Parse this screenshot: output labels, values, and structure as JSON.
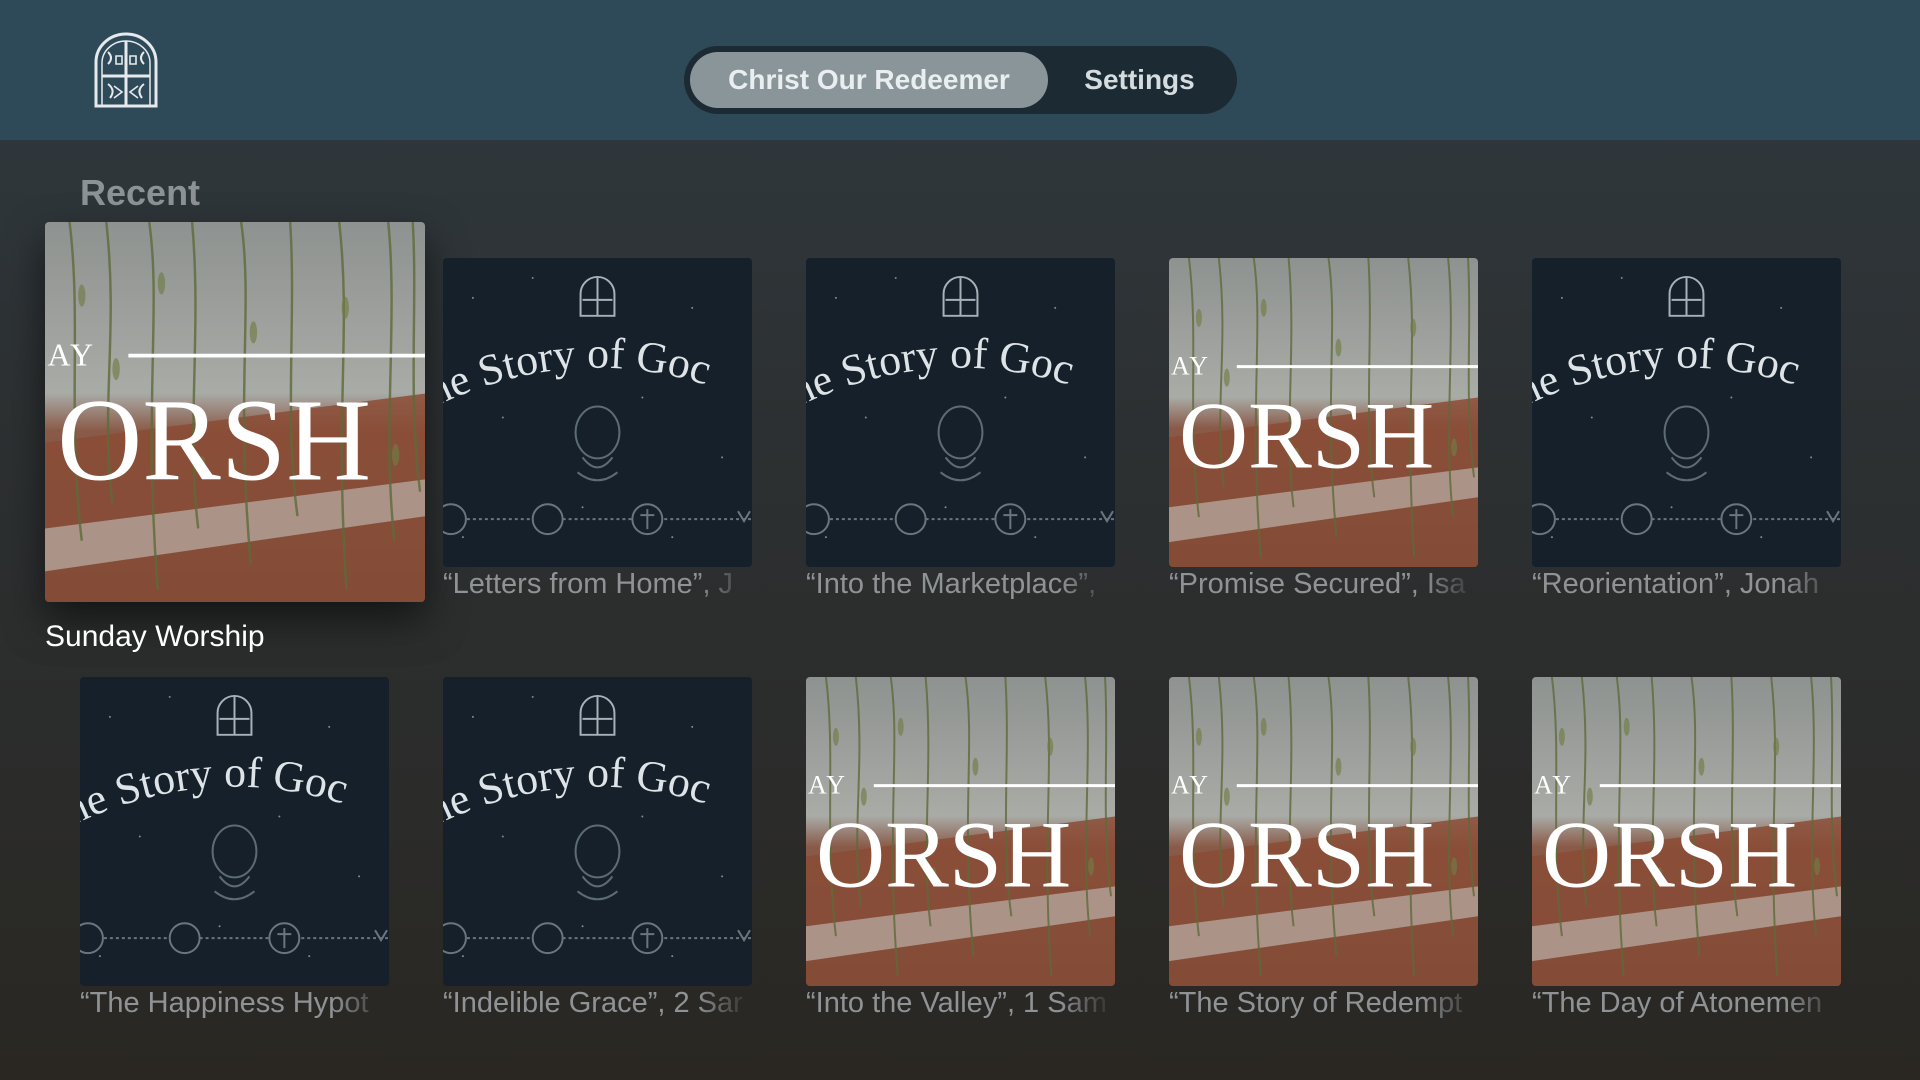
{
  "header": {
    "logo": "church-window-logo",
    "tabs": [
      {
        "label": "Christ Our Redeemer",
        "selected": true
      },
      {
        "label": "Settings",
        "selected": false
      }
    ]
  },
  "section": {
    "title": "Recent"
  },
  "artwork": {
    "worship": {
      "lead": "AY",
      "word": "ORSH"
    },
    "story": {
      "word": "he Story of Goc"
    }
  },
  "items": [
    {
      "title": "Sunday Worship",
      "art": "worship",
      "focused": true
    },
    {
      "title": "“Letters from Home”, J",
      "art": "story"
    },
    {
      "title": "“Into the Marketplace”,",
      "art": "story"
    },
    {
      "title": "“Promise Secured”, Isa",
      "art": "worship"
    },
    {
      "title": "“Reorientation”, Jonah",
      "art": "story"
    },
    {
      "title": "“The Happiness Hypot",
      "art": "story"
    },
    {
      "title": "“Indelible Grace”, 2 Sar",
      "art": "story"
    },
    {
      "title": "“Into the Valley”, 1 Sam",
      "art": "worship"
    },
    {
      "title": "“The Story of Redempt",
      "art": "worship"
    },
    {
      "title": "“The Day of Atonemen",
      "art": "worship"
    }
  ]
}
